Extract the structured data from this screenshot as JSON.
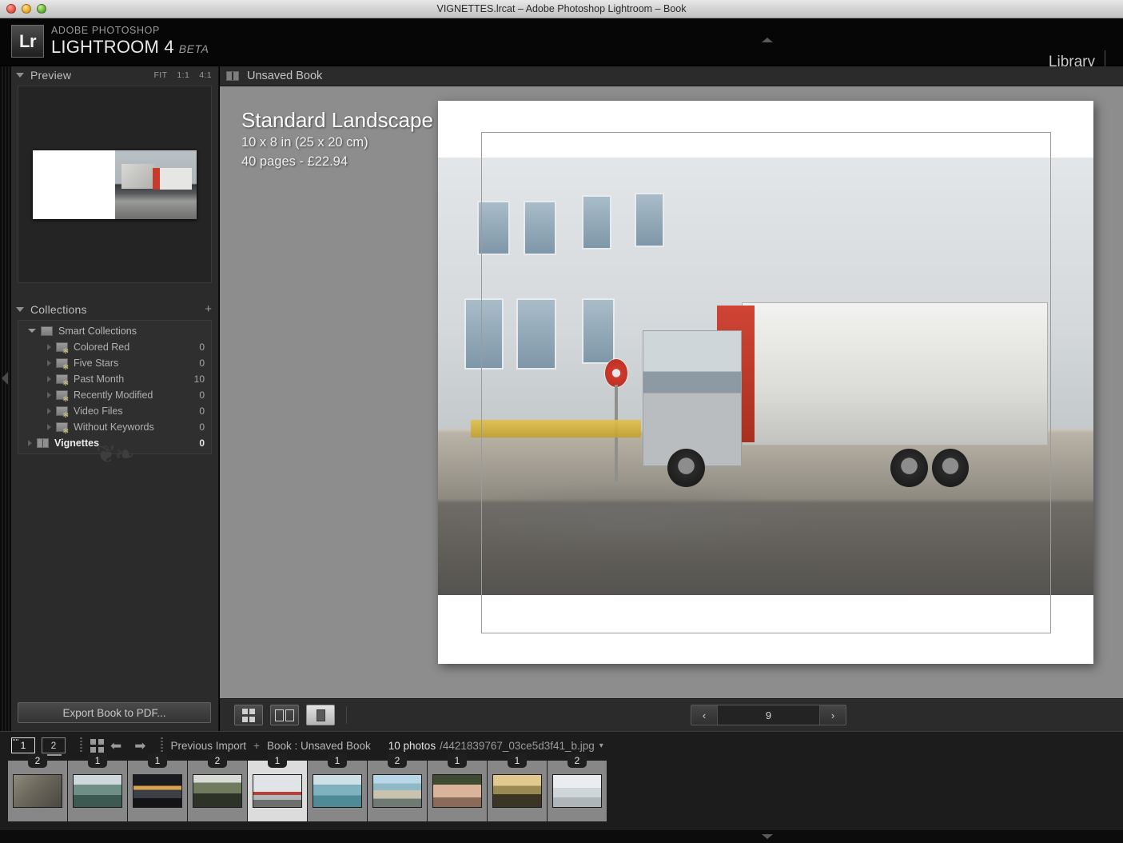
{
  "window": {
    "title": "VIGNETTES.lrcat – Adobe Photoshop Lightroom – Book"
  },
  "identity": {
    "badge": "Lr",
    "brand_small": "ADOBE PHOTOSHOP",
    "brand_main": "LIGHTROOM 4",
    "brand_beta": "BETA",
    "module": "Library"
  },
  "left_panel": {
    "preview": {
      "title": "Preview",
      "zoom_options": [
        "FIT",
        "1:1",
        "4:1"
      ]
    },
    "collections": {
      "title": "Collections",
      "add_label": "+",
      "groups": [
        {
          "label": "Smart Collections",
          "icon": "folder-icon",
          "expanded": true
        }
      ],
      "items": [
        {
          "label": "Colored Red",
          "count": "0",
          "icon": "smart-collection-icon"
        },
        {
          "label": "Five Stars",
          "count": "0",
          "icon": "smart-collection-icon"
        },
        {
          "label": "Past Month",
          "count": "10",
          "icon": "smart-collection-icon"
        },
        {
          "label": "Recently Modified",
          "count": "0",
          "icon": "smart-collection-icon"
        },
        {
          "label": "Video Files",
          "count": "0",
          "icon": "smart-collection-icon"
        },
        {
          "label": "Without Keywords",
          "count": "0",
          "icon": "smart-collection-icon"
        }
      ],
      "selected": {
        "label": "Vignettes",
        "count": "0",
        "icon": "book-collection-icon"
      }
    },
    "export_button": "Export Book to PDF..."
  },
  "content": {
    "header": {
      "title": "Unsaved Book",
      "icon": "book-spread-icon"
    },
    "book_info": {
      "title": "Standard Landscape",
      "size": "10 x 8 in (25 x 20 cm)",
      "pages_price": "40 pages - £22.94"
    },
    "toolbar": {
      "view_modes": [
        {
          "name": "multi-page-view",
          "active": false
        },
        {
          "name": "spread-view",
          "active": false
        },
        {
          "name": "single-page-view",
          "active": true
        }
      ],
      "pager": {
        "prev": "‹",
        "page": "9",
        "next": "›"
      }
    }
  },
  "filmstrip": {
    "sources": [
      {
        "label": "1",
        "active": true
      },
      {
        "label": "2",
        "active": false
      }
    ],
    "grid_icon": "grid-view-icon",
    "back_icon": "back-arrow-icon",
    "forward_icon": "forward-arrow-icon",
    "breadcrumbs": [
      {
        "label": "Previous Import"
      },
      {
        "label": "+"
      },
      {
        "label": "Book : Unsaved Book"
      }
    ],
    "photo_count": "10 photos",
    "file_name": "/4421839767_03ce5d3f41_b.jpg",
    "caret": "▾",
    "thumbnails": [
      {
        "badge": "2",
        "name": "thumbnail-pebbles",
        "selected": false,
        "css": "linear-gradient(135deg,#8f8a7e,#6f6a5e 40%,#4b4740)"
      },
      {
        "badge": "1",
        "name": "thumbnail-coast",
        "selected": false,
        "css": "linear-gradient(to bottom,#cfd8dd 0 30%,#6f8e86 30% 62%,#3d5a52 62% 100%)"
      },
      {
        "badge": "1",
        "name": "thumbnail-sunset",
        "selected": false,
        "css": "linear-gradient(to bottom,#1a1b20 0 34%,#d9a24e 34% 46%,#3b4046 46% 72%,#141417 72% 100%)"
      },
      {
        "badge": "2",
        "name": "thumbnail-field",
        "selected": false,
        "css": "linear-gradient(to bottom,#d8dcd4 0 24%,#6f7a5e 24% 58%,#2d3326 58% 100%)"
      },
      {
        "badge": "1",
        "name": "thumbnail-truck",
        "selected": true,
        "css": "linear-gradient(to bottom,#e1e4e6 0 52%,#b0443a 52% 62%,#b5b7b8 62% 78%,#6e6e6c 78% 100%)"
      },
      {
        "badge": "1",
        "name": "thumbnail-swimmer",
        "selected": false,
        "css": "linear-gradient(to bottom,#cfe0e6 0 30%,#7fb2be 30% 64%,#4f8a96 64% 100%)"
      },
      {
        "badge": "2",
        "name": "thumbnail-beach",
        "selected": false,
        "css": "linear-gradient(to bottom,#b9d7e6 0 26%,#8fb9c4 26% 48%,#c9c2ae 48% 74%,#6e7a72 74% 100%)"
      },
      {
        "badge": "1",
        "name": "thumbnail-crowd",
        "selected": false,
        "css": "linear-gradient(to bottom,#3f4a33 0 30%,#d9b49a 30% 70%,#8a6a58 70% 100%)"
      },
      {
        "badge": "1",
        "name": "thumbnail-meadow",
        "selected": false,
        "css": "linear-gradient(to bottom,#e2c98f 0 34%,#9a8a52 34% 60%,#3a3524 60% 100%)"
      },
      {
        "badge": "2",
        "name": "thumbnail-snow",
        "selected": false,
        "css": "linear-gradient(to bottom,#e9edf0 0 40%,#cfd6da 40% 70%,#aeb6ba 70% 100%)"
      }
    ]
  }
}
